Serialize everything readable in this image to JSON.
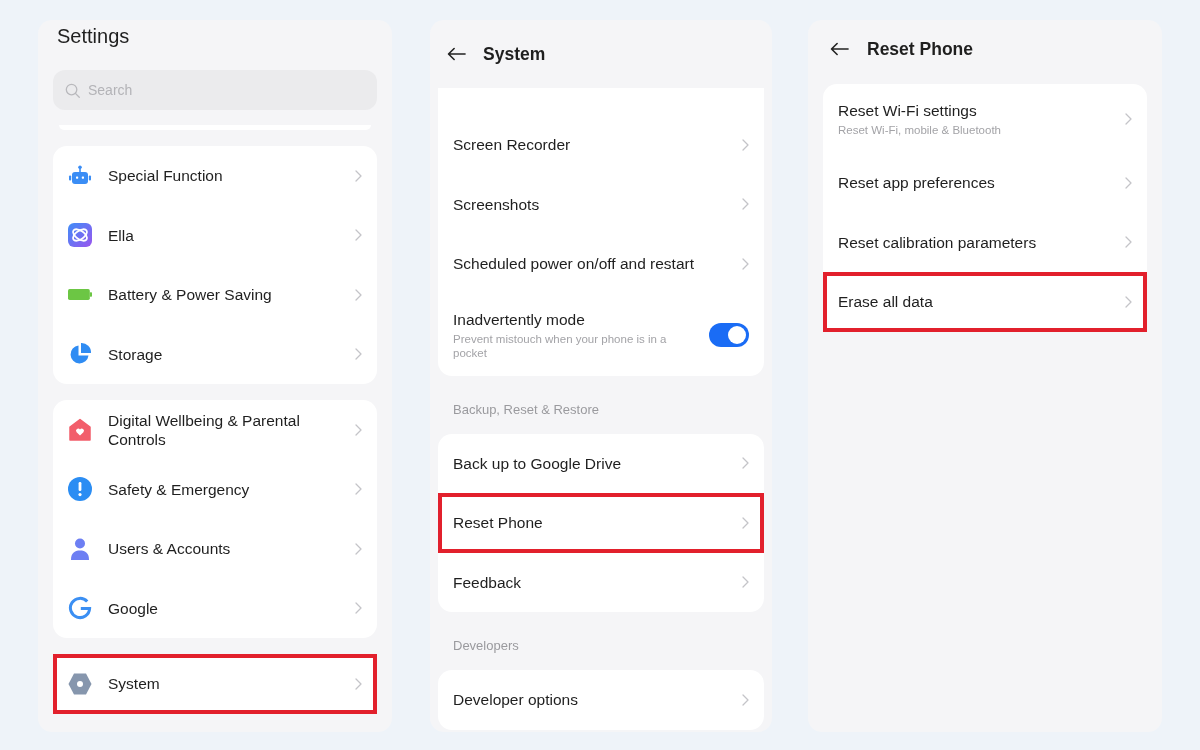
{
  "screens": [
    {
      "kind": "main",
      "title": "Settings",
      "search": {
        "placeholder": "Search"
      },
      "sections": [
        {
          "clipped": false,
          "items": [
            {
              "kind": "link",
              "label": "Special Function",
              "highlighted": false
            },
            {
              "kind": "link",
              "label": "Ella",
              "highlighted": false
            },
            {
              "kind": "link",
              "label": "Battery & Power Saving",
              "highlighted": false
            },
            {
              "kind": "link",
              "label": "Storage",
              "highlighted": false
            }
          ]
        },
        {
          "clipped": false,
          "items": [
            {
              "kind": "link",
              "label": "Digital Wellbeing & Parental Controls",
              "highlighted": false
            },
            {
              "kind": "link",
              "label": "Safety & Emergency",
              "highlighted": false
            },
            {
              "kind": "link",
              "label": "Users & Accounts",
              "highlighted": false
            },
            {
              "kind": "link",
              "label": "Google",
              "highlighted": false
            }
          ]
        },
        {
          "clipped": false,
          "items": [
            {
              "kind": "link",
              "label": "System",
              "highlighted": true
            }
          ]
        }
      ]
    },
    {
      "kind": "subpage",
      "title": "System",
      "sections": [
        {
          "clipped": true,
          "items": [
            {
              "kind": "link",
              "label": "Screen Recorder",
              "highlighted": false
            },
            {
              "kind": "link",
              "label": "Screenshots",
              "highlighted": false
            },
            {
              "kind": "link",
              "label": "Scheduled power on/off and restart",
              "highlighted": false
            },
            {
              "kind": "toggle",
              "label": "Inadvertently mode",
              "subtitle": "Prevent mistouch when your phone is in a pocket",
              "on": true,
              "highlighted": false
            }
          ]
        },
        {
          "header": "Backup, Reset & Restore",
          "clipped": false,
          "items": [
            {
              "kind": "link",
              "label": "Back up to Google Drive",
              "highlighted": false
            },
            {
              "kind": "link",
              "label": "Reset Phone",
              "highlighted": true
            },
            {
              "kind": "link",
              "label": "Feedback",
              "highlighted": false
            }
          ]
        },
        {
          "header": "Developers",
          "clipped": false,
          "items": [
            {
              "kind": "link",
              "label": "Developer options",
              "highlighted": false
            }
          ]
        }
      ]
    },
    {
      "kind": "subpage",
      "title": "Reset Phone",
      "sections": [
        {
          "clipped": false,
          "items": [
            {
              "kind": "link",
              "label": "Reset Wi-Fi settings",
              "subtitle": "Reset Wi-Fi, mobile & Bluetooth",
              "highlighted": false
            },
            {
              "kind": "link",
              "label": "Reset app preferences",
              "highlighted": false
            },
            {
              "kind": "link",
              "label": "Reset calibration parameters",
              "highlighted": false
            },
            {
              "kind": "link",
              "label": "Erase all data",
              "highlighted": true
            }
          ]
        }
      ]
    }
  ]
}
